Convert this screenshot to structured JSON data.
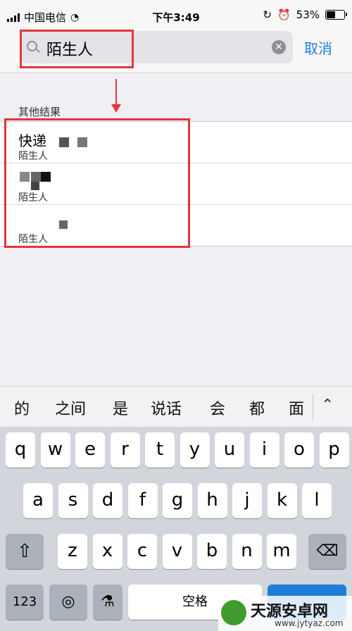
{
  "status": {
    "carrier": "中国电信",
    "time": "下午3:49",
    "battery": "53%",
    "battery_level": 0.53
  },
  "search": {
    "query": "陌生人",
    "cancel": "取消"
  },
  "results": {
    "section_title": "其他结果",
    "rows": [
      {
        "name": "快递",
        "sub": "陌生人"
      },
      {
        "name": "",
        "sub": "陌生人"
      },
      {
        "name": "",
        "sub": "陌生人"
      }
    ]
  },
  "suggestions": [
    "的",
    "之间",
    "是",
    "说话",
    "会",
    "都",
    "面"
  ],
  "keyboard": {
    "row1": [
      "q",
      "w",
      "e",
      "r",
      "t",
      "y",
      "u",
      "i",
      "o",
      "p"
    ],
    "row2": [
      "a",
      "s",
      "d",
      "f",
      "g",
      "h",
      "j",
      "k",
      "l"
    ],
    "row3": [
      "z",
      "x",
      "c",
      "v",
      "b",
      "n",
      "m"
    ],
    "mode_label": "123",
    "space_label": "空格"
  },
  "watermark": {
    "title": "天源安卓网",
    "url": "www.jytyaz.com"
  }
}
